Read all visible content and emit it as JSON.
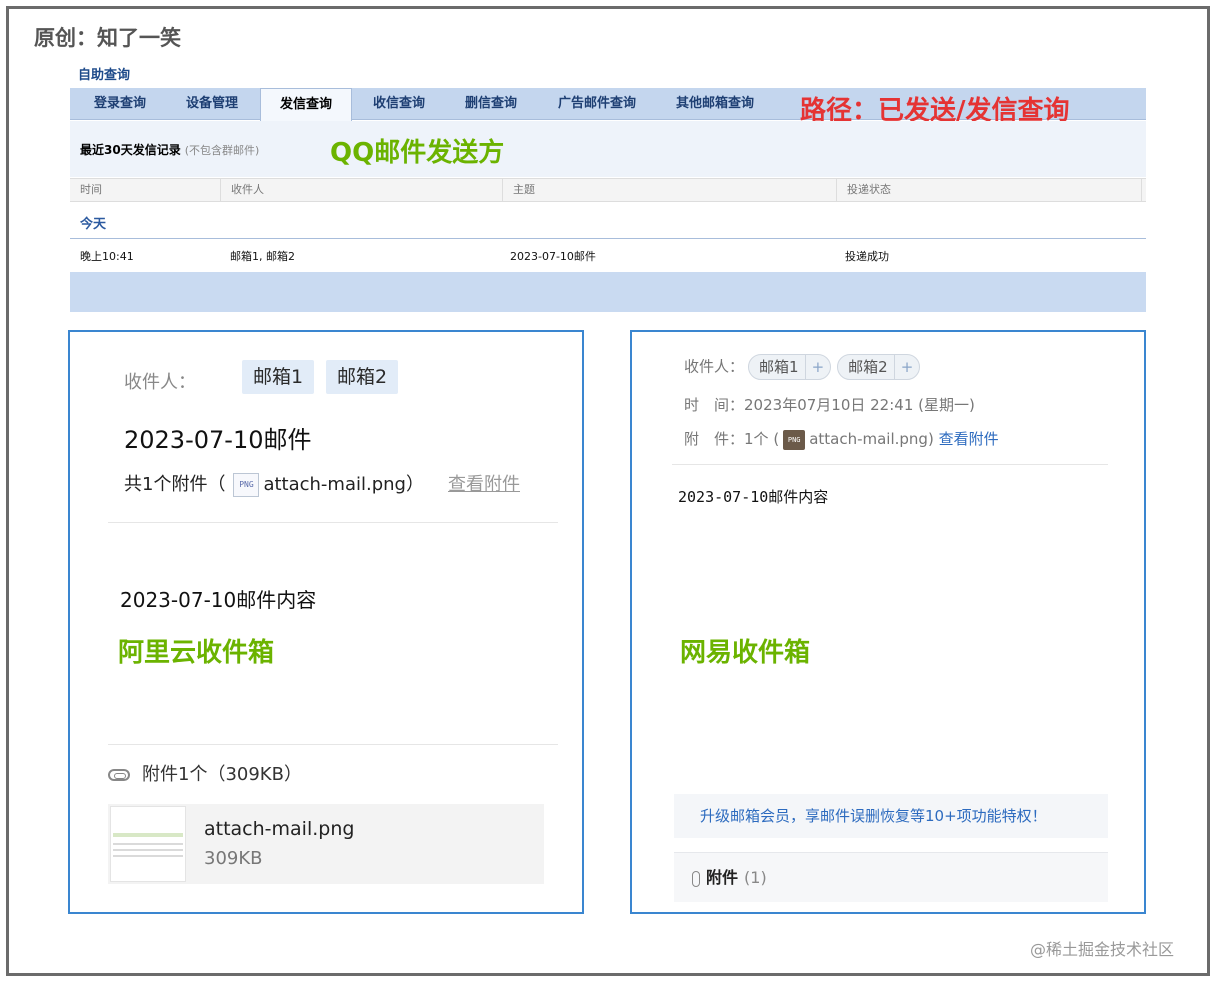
{
  "author_caption": "原创：知了一笑",
  "qq": {
    "section_title": "自助查询",
    "tabs": [
      "登录查询",
      "设备管理",
      "发信查询",
      "收信查询",
      "删信查询",
      "广告邮件查询",
      "其他邮箱查询"
    ],
    "active_tab": "发信查询",
    "path_note": "路径：已发送/发信查询",
    "record_title": "最近30天发信记录",
    "record_subtitle": "(不包含群邮件)",
    "sender_note": "QQ邮件发送方",
    "columns": [
      "时间",
      "收件人",
      "主题",
      "投递状态"
    ],
    "group_label": "今天",
    "rows": [
      {
        "time": "晚上10:41",
        "recipients": "邮箱1, 邮箱2",
        "subject": "2023-07-10邮件",
        "status": "投递成功"
      }
    ]
  },
  "aliyun": {
    "recipient_label": "收件人：",
    "recipients": [
      "邮箱1",
      "邮箱2"
    ],
    "subject": "2023-07-10邮件",
    "attach_prefix": "共1个附件（",
    "attach_icon": "PNG",
    "attach_name": "attach-mail.png",
    "attach_suffix": "）",
    "view_attach": "查看附件",
    "body": "2023-07-10邮件内容",
    "inbox_note": "阿里云收件箱",
    "attach_count": "附件1个（309KB）",
    "file_name": "attach-mail.png",
    "file_size": "309KB"
  },
  "netease": {
    "recipient_label": "收件人：",
    "recipients": [
      "邮箱1",
      "邮箱2"
    ],
    "plus": "+",
    "time_label": "时　间：",
    "time_value": "2023年07月10日 22:41 (星期一)",
    "attach_label": "附　件：",
    "attach_prefix": "1个 (",
    "attach_icon": "PNG",
    "attach_name": "attach-mail.png",
    "attach_suffix": ")",
    "view_attach": "查看附件",
    "body": "2023-07-10邮件内容",
    "inbox_note": "网易收件箱",
    "promo": "升级邮箱会员，享邮件误删恢复等10+项功能特权！",
    "attach_section_label": "附件",
    "attach_section_count": "(1)"
  },
  "watermark": "@稀土掘金技术社区",
  "colors": {
    "tab_bar": "#c4d6ee",
    "note_red": "#e53333",
    "note_green": "#6bb300",
    "panel_border": "#3a86d0",
    "link_blue": "#2d6bbf"
  }
}
